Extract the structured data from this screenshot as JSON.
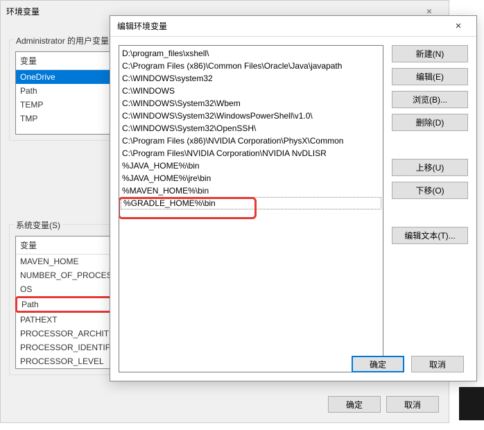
{
  "parent": {
    "title": "环境变量",
    "close_x": "×",
    "user_vars_label": "Administrator 的用户变量",
    "user_var_header": "变量",
    "user_vars": [
      "OneDrive",
      "Path",
      "TEMP",
      "TMP"
    ],
    "sys_vars_label": "系统变量(S)",
    "sys_var_header": "变量",
    "sys_vars": [
      "MAVEN_HOME",
      "NUMBER_OF_PROCESSORS",
      "OS",
      "Path",
      "PATHEXT",
      "PROCESSOR_ARCHITECTURE",
      "PROCESSOR_IDENTIFIER",
      "PROCESSOR_LEVEL"
    ],
    "ok": "确定",
    "cancel": "取消"
  },
  "dialog": {
    "title": "编辑环境变量",
    "close_x": "×",
    "paths": [
      "D:\\program_files\\xshell\\",
      "C:\\Program Files (x86)\\Common Files\\Oracle\\Java\\javapath",
      "C:\\WINDOWS\\system32",
      "C:\\WINDOWS",
      "C:\\WINDOWS\\System32\\Wbem",
      "C:\\WINDOWS\\System32\\WindowsPowerShell\\v1.0\\",
      "C:\\WINDOWS\\System32\\OpenSSH\\",
      "C:\\Program Files (x86)\\NVIDIA Corporation\\PhysX\\Common",
      "C:\\Program Files\\NVIDIA Corporation\\NVIDIA NvDLISR",
      "%JAVA_HOME%\\bin",
      "%JAVA_HOME%\\jre\\bin",
      "%MAVEN_HOME%\\bin",
      "%GRADLE_HOME%\\bin"
    ],
    "buttons": {
      "new": "新建(N)",
      "edit": "编辑(E)",
      "browse": "浏览(B)...",
      "delete": "删除(D)",
      "move_up": "上移(U)",
      "move_down": "下移(O)",
      "edit_text": "编辑文本(T)..."
    },
    "ok": "确定",
    "cancel": "取消"
  }
}
